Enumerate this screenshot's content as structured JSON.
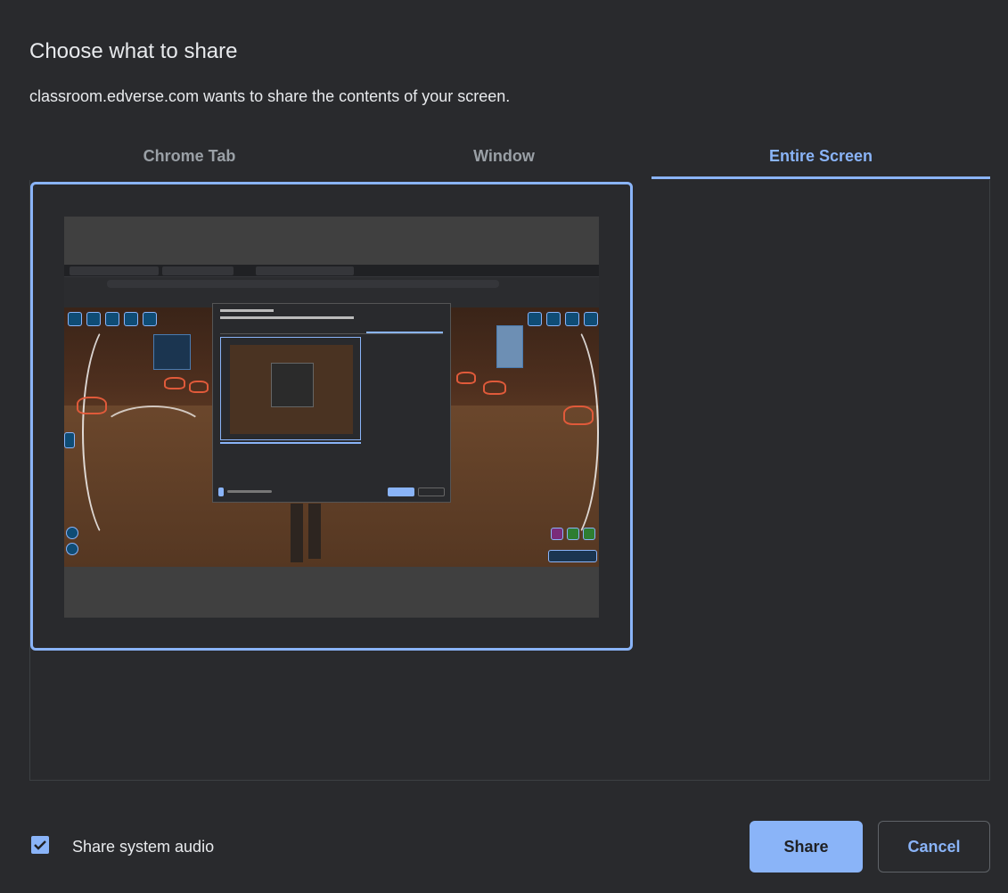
{
  "dialog": {
    "title": "Choose what to share",
    "subtitle": "classroom.edverse.com wants to share the contents of your screen."
  },
  "tabs": [
    {
      "label": "Chrome Tab",
      "selected": false
    },
    {
      "label": "Window",
      "selected": false
    },
    {
      "label": "Entire Screen",
      "selected": true
    }
  ],
  "screen_preview": {
    "selected": true,
    "icon": "desktop-thumbnail"
  },
  "footer": {
    "audio_checked": true,
    "audio_label": "Share system audio",
    "share_label": "Share",
    "cancel_label": "Cancel"
  },
  "colors": {
    "background": "#292a2d",
    "accent": "#8ab4f8",
    "text": "#e8eaed",
    "muted": "#9aa0a6"
  }
}
